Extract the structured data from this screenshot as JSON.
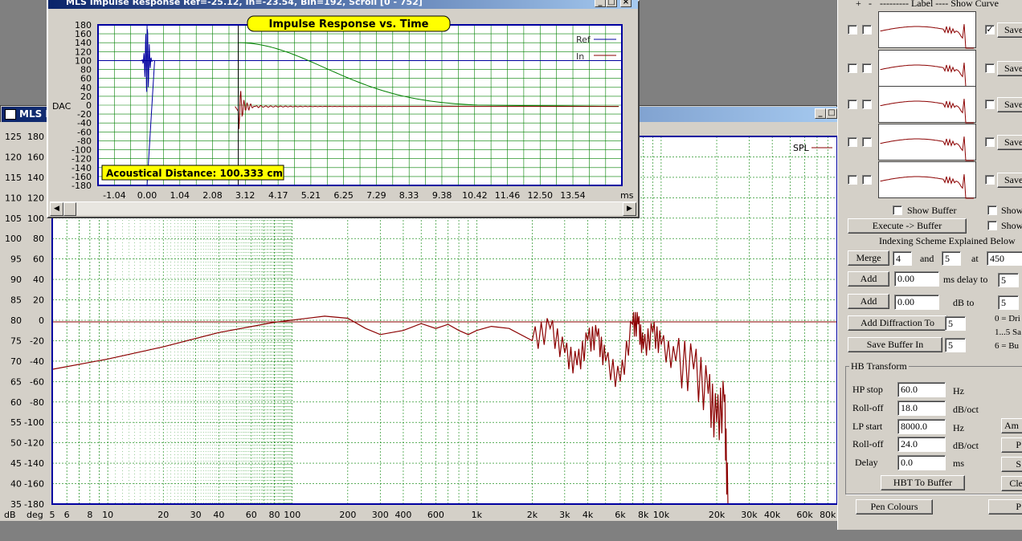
{
  "impulse_window": {
    "title": "MLS Impulse Response  Ref=-25.12, In=-23.54, Bin=192, Scroll [0 - 752]",
    "chart_title": "Impulse Response vs. Time",
    "y_axis_label": "DAC",
    "x_unit": "ms",
    "y_ticks": [
      "180",
      "160",
      "140",
      "120",
      "100",
      "80",
      "60",
      "40",
      "20",
      "0",
      "-20",
      "-40",
      "-60",
      "-80",
      "-100",
      "-120",
      "-140",
      "-160",
      "-180"
    ],
    "x_ticks": [
      "-1.04",
      "0.00",
      "1.04",
      "2.08",
      "3.12",
      "4.17",
      "5.21",
      "6.25",
      "7.29",
      "8.33",
      "9.38",
      "10.42",
      "11.46",
      "12.50",
      "13.54"
    ],
    "legend_ref": "Ref",
    "legend_in": "In",
    "distance_label": "Acoustical Distance: 100.333 cm"
  },
  "fr_window": {
    "title": "MLS FR",
    "db_ticks": [
      "125",
      "120",
      "115",
      "110",
      "105",
      "100",
      "95",
      "90",
      "85",
      "80",
      "75",
      "70",
      "65",
      "60",
      "55",
      "50",
      "45",
      "40",
      "35"
    ],
    "deg_ticks": [
      "180",
      "160",
      "140",
      "120",
      "100",
      "80",
      "60",
      "40",
      "20",
      "0",
      "-20",
      "-40",
      "-60",
      "-80",
      "-100",
      "-120",
      "-140",
      "-160",
      "-180"
    ],
    "unit_db": "dB",
    "unit_deg": "deg",
    "x_ticks": [
      "5",
      "6",
      "8",
      "10",
      "20",
      "30",
      "40",
      "60",
      "80",
      "100",
      "200",
      "300",
      "400",
      "600",
      "1k",
      "2k",
      "3k",
      "4k",
      "6k",
      "8k",
      "10k",
      "20k",
      "30k",
      "40k",
      "60k",
      "80k"
    ],
    "legend_spl": "SPL"
  },
  "panel": {
    "header_plus": "+",
    "header_minus": "-",
    "header_label": "--------- Label  ---- Show Curve",
    "save_label": "Save",
    "show_buffer": "Show Buffer",
    "show_cut": "Show",
    "execute_buffer": "Execute -> Buffer",
    "indexing_text": "Indexing Scheme Explained Below",
    "merge": "Merge",
    "merge_a": "4",
    "and": "and",
    "merge_b": "5",
    "at": "at",
    "merge_at": "450",
    "add": "Add",
    "add_ms_value": "0.00",
    "ms_delay_to": "ms delay to",
    "add_ms_target": "5",
    "add_db_value": "0.00",
    "db_to": "dB to",
    "add_db_target": "5",
    "add_diffraction": "Add Diffraction To",
    "diffraction_target": "5",
    "save_buffer_in": "Save Buffer In",
    "save_buffer_target": "5",
    "note0": "0 = Dri",
    "note1": "1...5 Sa",
    "note6": "6 = Bu",
    "hb_title": "HB Transform",
    "hp_stop_label": "HP stop",
    "hp_stop_value": "60.0",
    "hz": "Hz",
    "rolloff_label": "Roll-off",
    "rolloff1_value": "18.0",
    "db_oct": "dB/oct",
    "lp_start_label": "LP start",
    "lp_start_value": "8000.0",
    "rolloff2_value": "24.0",
    "delay_label": "Delay",
    "delay_value": "0.0",
    "ms": "ms",
    "hbt_to_buffer": "HBT To Buffer",
    "amp_cut": "Am",
    "p_cut": "P",
    "s_cut": "S",
    "cle_cut": "Cle",
    "pen_colours": "Pen Colours",
    "p2_cut": "P"
  },
  "colors": {
    "grid": "#008000",
    "plot_border": "#0000a0",
    "response": "#8b0000",
    "envelope": "#008000",
    "impulse_ref": "#0000a0",
    "distance_bg": "#ffff00"
  },
  "chart_data": [
    {
      "type": "line",
      "title": "Impulse Response vs. Time",
      "xlabel": "ms",
      "ylabel": "DAC",
      "xlim": [
        -1.56,
        15.1
      ],
      "ylim": [
        -180,
        180
      ],
      "series": [
        {
          "name": "Ref",
          "x": [
            -0.15,
            -0.05,
            0.0,
            0.05,
            0.1,
            0.2
          ],
          "y": [
            -30,
            60,
            150,
            -110,
            40,
            10
          ]
        },
        {
          "name": "In",
          "x": [
            2.9,
            3.0,
            3.1,
            3.3,
            3.6,
            4.0,
            5.0,
            7.0,
            9.0,
            10.0,
            15.0
          ],
          "y": [
            -3,
            30,
            -10,
            5,
            3,
            2,
            0,
            0,
            0,
            0,
            0
          ]
        }
      ],
      "grid": true,
      "legend": "top-right"
    },
    {
      "type": "line",
      "xlabel": "",
      "ylabel": "dB",
      "xscale": "log",
      "xlim": [
        5,
        90000
      ],
      "ylim": [
        35,
        125
      ],
      "series": [
        {
          "name": "SPL",
          "x": [
            5,
            10,
            20,
            40,
            80,
            150,
            200,
            250,
            300,
            400,
            500,
            600,
            700,
            800,
            900,
            1000,
            1200,
            1500,
            2000,
            2500,
            3000,
            3500,
            4000,
            4500,
            5000,
            6000,
            7000,
            7500,
            8000,
            9000,
            10000,
            12000,
            15000,
            18000,
            20000,
            22000,
            23000
          ],
          "y": [
            68,
            70.5,
            73.5,
            77,
            79.5,
            81,
            80.5,
            78,
            76.5,
            77.5,
            79.2,
            78,
            79,
            77.5,
            76.5,
            77.5,
            78.5,
            78,
            75,
            78,
            72,
            69,
            75,
            76,
            70,
            65,
            79,
            79,
            73,
            77,
            74,
            70,
            68,
            62,
            55,
            60,
            35
          ]
        }
      ],
      "grid": true,
      "legend": "top-right"
    }
  ]
}
